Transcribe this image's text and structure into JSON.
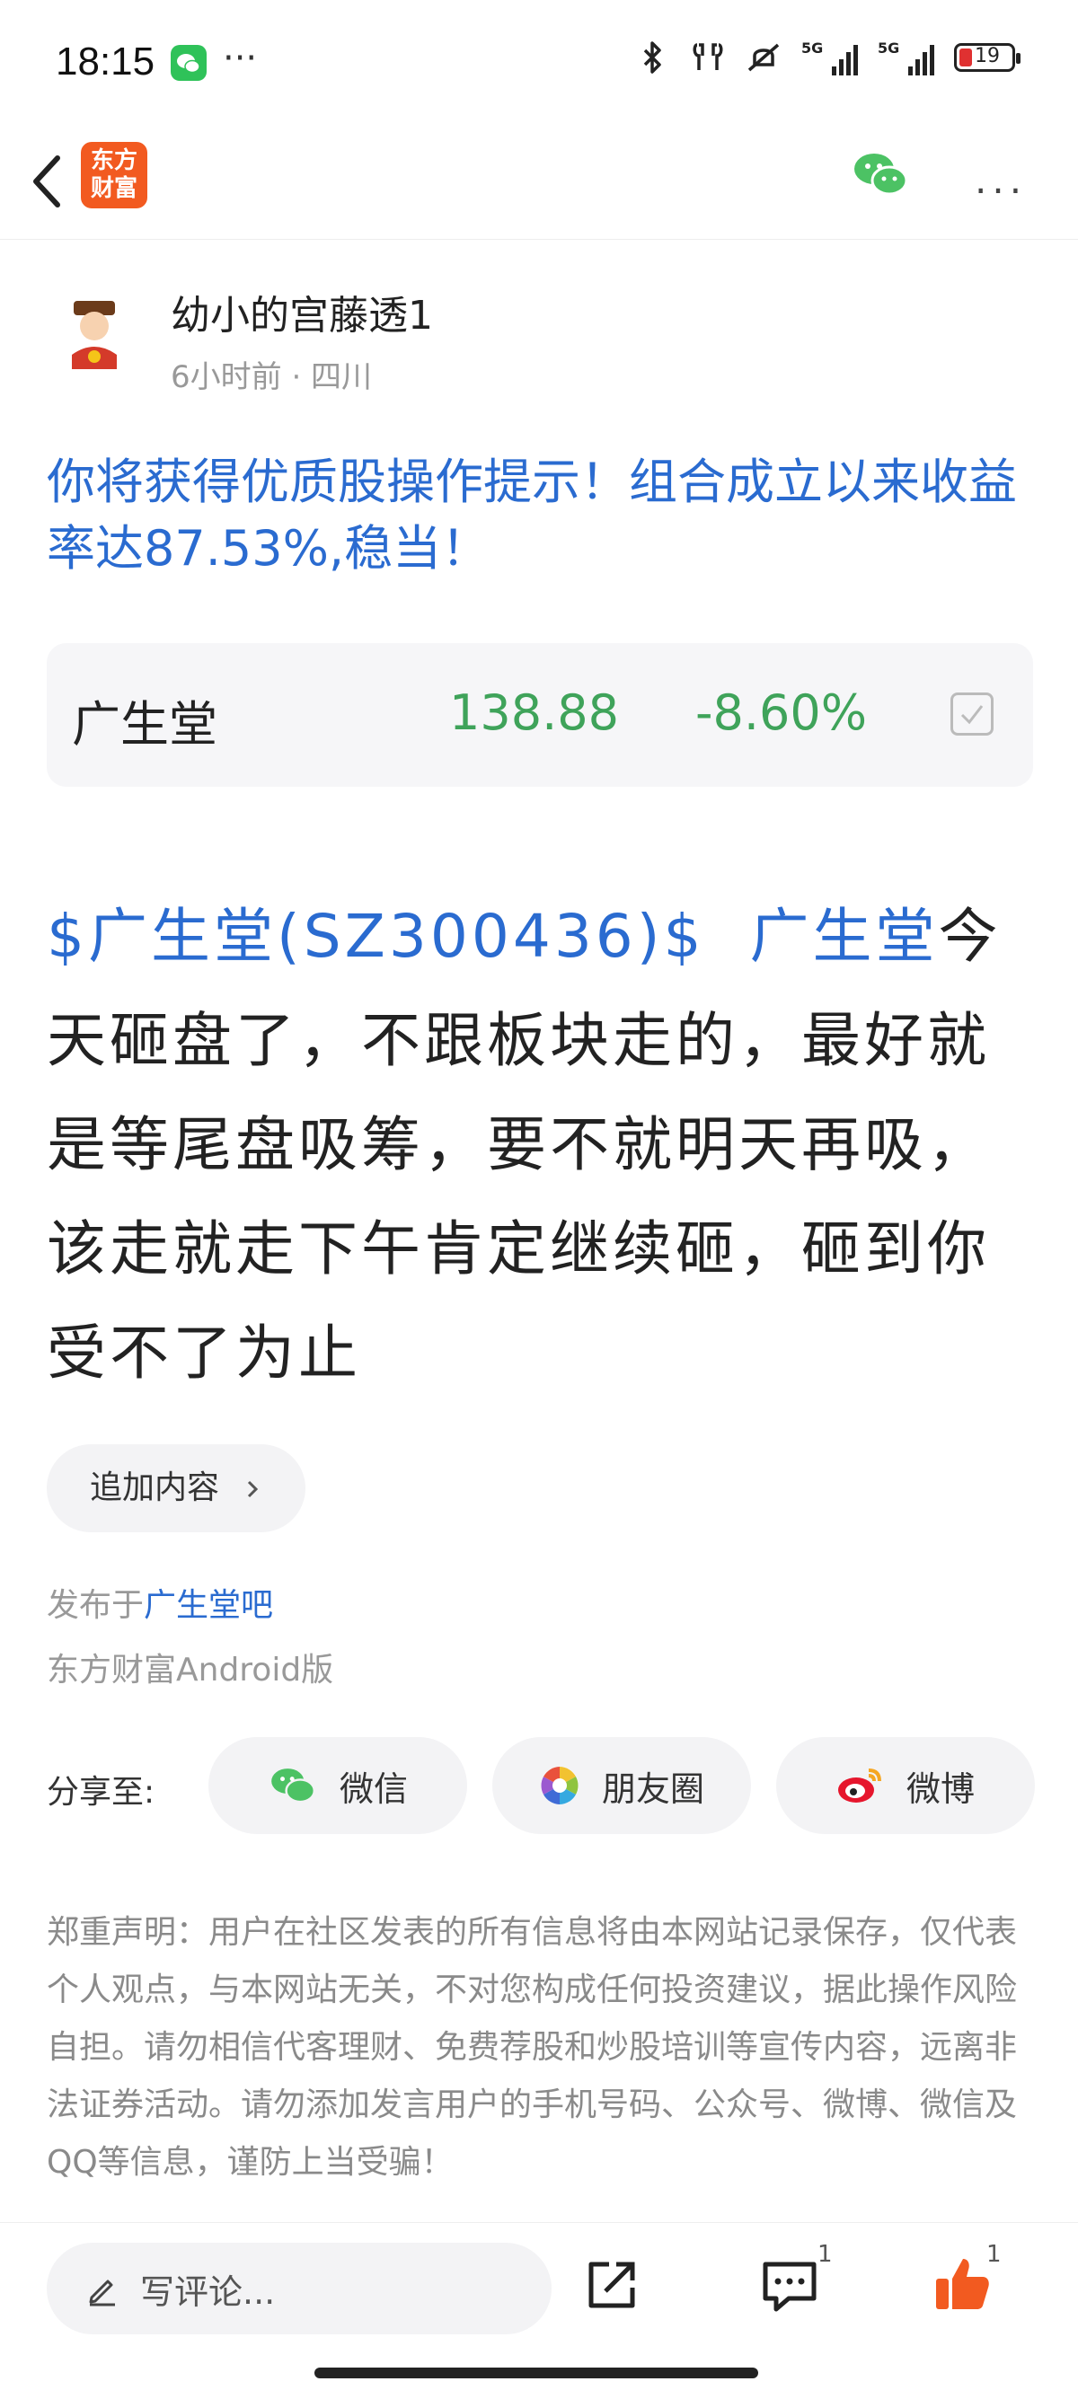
{
  "status_bar": {
    "time": "18:15",
    "more": "···",
    "signal1_label": "5G",
    "signal2_label": "5G",
    "battery": "19"
  },
  "nav": {
    "logo_line1": "东方",
    "logo_line2": "财富",
    "more": "···"
  },
  "author": {
    "name": "幼小的宫藤透1",
    "meta": "6小时前 · 四川"
  },
  "post": {
    "title": "你将获得优质股操作提示！组合成立以来收益率达87.53%,稳当！",
    "stock": {
      "name": "广生堂",
      "price": "138.88",
      "change": "-8.60%",
      "price_color": "#3fa35a"
    },
    "body_link1": "$广生堂(SZ300436)$",
    "body_link2": "广生堂",
    "body_text": "今天砸盘了，不跟板块走的，最好就是等尾盘吸筹，要不就明天再吸，该走就走下午肯定继续砸，砸到你受不了为止",
    "append_label": "追加内容",
    "posted_prefix": "发布于",
    "forum": "广生堂吧",
    "client": "东方财富Android版"
  },
  "share": {
    "label": "分享至:",
    "wechat": "微信",
    "moments": "朋友圈",
    "weibo": "微博"
  },
  "disclaimer": "郑重声明：用户在社区发表的所有信息将由本网站记录保存，仅代表个人观点，与本网站无关，不对您构成任何投资建议，据此操作风险自担。请勿相信代客理财、免费荐股和炒股培训等宣传内容，远离非法证券活动。请勿添加发言用户的手机号码、公众号、微博、微信及QQ等信息，谨防上当受骗！",
  "bottom_bar": {
    "comment_placeholder": "写评论...",
    "comment_count": "1",
    "like_count": "1"
  },
  "colors": {
    "link_blue": "#2a6bd0",
    "brand_orange": "#f25a20",
    "down_green": "#3fa35a"
  }
}
